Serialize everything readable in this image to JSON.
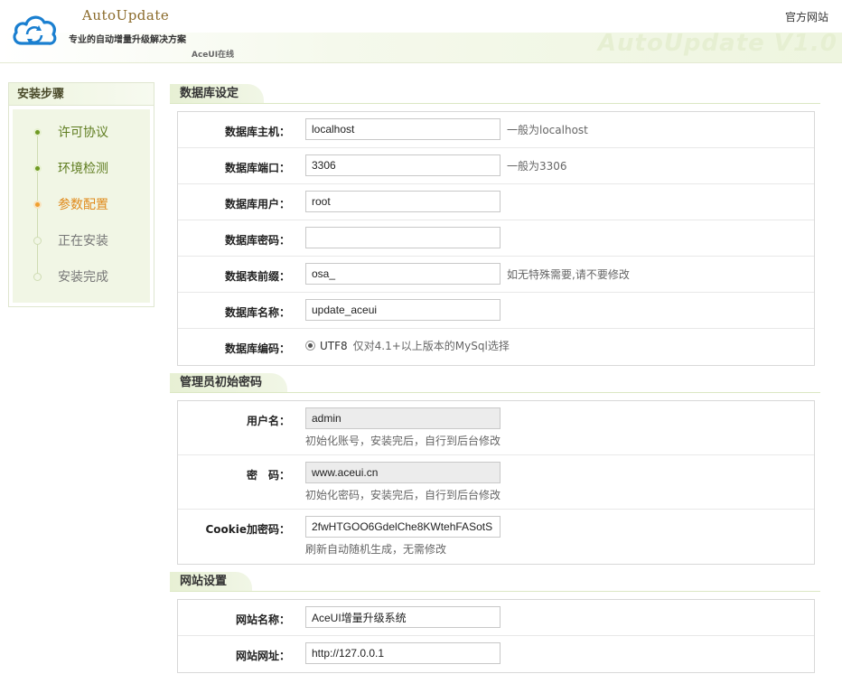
{
  "header": {
    "app_name": "AutoUpdate",
    "slogan": "专业的自动增量升级解决方案",
    "sub": "AceUI在线",
    "site_link": "官方网站",
    "watermark": "AutoUpdate V1.0"
  },
  "sidebar": {
    "title": "安装步骤",
    "steps": [
      {
        "label": "许可协议",
        "state": "done"
      },
      {
        "label": "环境检测",
        "state": "done"
      },
      {
        "label": "参数配置",
        "state": "current"
      },
      {
        "label": "正在安装",
        "state": "todo"
      },
      {
        "label": "安装完成",
        "state": "todo"
      }
    ]
  },
  "db": {
    "title": "数据库设定",
    "host": {
      "label": "数据库主机：",
      "value": "localhost",
      "hint": "一般为localhost"
    },
    "port": {
      "label": "数据库端口：",
      "value": "3306",
      "hint": "一般为3306"
    },
    "user": {
      "label": "数据库用户：",
      "value": "root"
    },
    "password": {
      "label": "数据库密码：",
      "value": ""
    },
    "prefix": {
      "label": "数据表前缀：",
      "value": "osa_",
      "hint": "如无特殊需要,请不要修改"
    },
    "name": {
      "label": "数据库名称：",
      "value": "update_aceui"
    },
    "charset": {
      "label": "数据库编码：",
      "option": "UTF8",
      "hint": "仅对4.1+以上版本的MySql选择"
    }
  },
  "admin": {
    "title": "管理员初始密码",
    "username": {
      "label": "用户名：",
      "value": "admin",
      "hint": "初始化账号，安装完后，自行到后台修改"
    },
    "password": {
      "label": "密　码：",
      "value": "www.aceui.cn",
      "hint": "初始化密码，安装完后，自行到后台修改"
    },
    "cookie": {
      "label": "Cookie加密码：",
      "value": "2fwHTGOO6GdelChe8KWtehFASotS",
      "hint": "刷新自动随机生成，无需修改"
    }
  },
  "site": {
    "title": "网站设置",
    "name": {
      "label": "网站名称：",
      "value": "AceUI增量升级系统"
    },
    "url": {
      "label": "网站网址：",
      "value": "http://127.0.0.1"
    }
  },
  "colors": {
    "accent_green": "#6f9a23",
    "accent_orange": "#f0a030",
    "brand_blue": "#1a7fd0"
  }
}
